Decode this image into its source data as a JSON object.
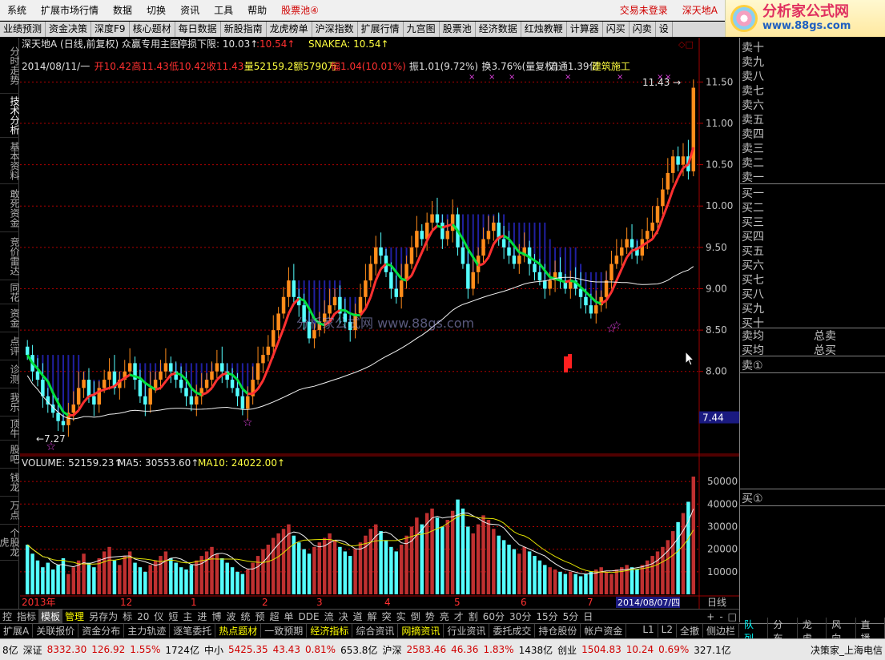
{
  "menu": [
    "系统",
    "扩展市场行情",
    "数据",
    "切换",
    "资讯",
    "工具",
    "帮助"
  ],
  "menu_pool": "股票池④",
  "menu_login": "交易未登录",
  "menu_stock": "深天地A",
  "logo_text": "分析家公式网",
  "logo_url": "www.88gs.com",
  "toolbar": [
    "业绩预测",
    "资金决策",
    "深度F9",
    "核心题材",
    "每日数据",
    "新股指南",
    "龙虎榜单",
    "沪深指数",
    "扩展行情",
    "九宫图",
    "股票池",
    "经济数据",
    "红烛教鞭",
    "计算器",
    "闪买",
    "闪卖",
    "设"
  ],
  "left_tabs": [
    "分时走势",
    "技术分析",
    "基本资料",
    "敢死资金",
    "竞价雷达",
    "同花",
    "资金",
    "点评",
    "诊测",
    "我乐",
    "顶牛",
    "股吧",
    "钱龙",
    "万点",
    "个股龙虎"
  ],
  "chart_header": {
    "title": "深天地A (日线,前复权) 众赢专用主图",
    "stop_loss_label": "停损下限:",
    "stop_loss": "10.03",
    "stop_loss2": "10.54",
    "snakea": "SNAKEA: 10.54"
  },
  "info_line": {
    "date": "2014/08/11/一",
    "open": "开10.42",
    "high": "高11.43",
    "low": "低10.42",
    "close": "收11.43",
    "vol": "量52159.2",
    "amount": "额5790万",
    "amp": "幅1.04(10.01%)",
    "swing": "振1.01(9.72%)",
    "turnover": "换3.76%(量复权)",
    "float": "流通1.39亿",
    "industry": "建筑施工"
  },
  "volume_header": {
    "vol": "VOLUME: 52159.23",
    "ma5": "MA5: 30553.60",
    "ma10": "MA10: 24022.00"
  },
  "annotations": {
    "high_label": "11.43",
    "low_label": "7.27",
    "current_price": "7.44",
    "watermark": "分析家公式网  www.88gs.com",
    "period": "日线",
    "cursor_date": "2014/08/07/四"
  },
  "chart_data": {
    "type": "candlestick",
    "price_axis": {
      "min": 7.0,
      "max": 11.6,
      "ticks": [
        8.0,
        8.5,
        9.0,
        9.5,
        10.0,
        10.5,
        11.0,
        11.5
      ]
    },
    "volume_axis": {
      "min": 0,
      "max": 55000,
      "ticks": [
        10000,
        20000,
        30000,
        40000,
        50000
      ]
    },
    "x_labels": [
      "2013年",
      "12",
      "1",
      "2",
      "3",
      "4",
      "5",
      "6",
      "7"
    ],
    "series": {
      "open": [
        8.3,
        8.2,
        8.0,
        7.9,
        7.7,
        7.6,
        7.5,
        7.4,
        7.35,
        7.5,
        7.6,
        7.8,
        7.9,
        7.7,
        7.6,
        7.8,
        7.9,
        8.0,
        7.8,
        7.9,
        8.0,
        8.1,
        7.9,
        7.7,
        7.6,
        7.8,
        7.9,
        8.0,
        8.1,
        8.0,
        7.9,
        7.8,
        7.7,
        7.6,
        7.7,
        7.8,
        7.9,
        8.0,
        8.1,
        8.0,
        7.9,
        7.8,
        7.7,
        7.55,
        7.7,
        7.9,
        8.1,
        8.2,
        8.3,
        8.5,
        8.7,
        8.9,
        9.1,
        8.9,
        8.8,
        8.6,
        8.4,
        8.5,
        8.6,
        8.7,
        8.8,
        8.9,
        8.7,
        8.6,
        8.5,
        8.7,
        8.9,
        9.1,
        9.3,
        9.5,
        9.4,
        9.2,
        9.0,
        8.9,
        9.1,
        9.3,
        9.5,
        9.7,
        9.6,
        9.8,
        9.9,
        9.8,
        9.6,
        9.7,
        9.9,
        9.5,
        9.3,
        9.0,
        9.2,
        9.4,
        9.6,
        9.7,
        9.8,
        9.6,
        9.5,
        9.4,
        9.3,
        9.4,
        9.5,
        9.3,
        9.2,
        9.1,
        9.0,
        9.1,
        9.2,
        9.1,
        9.0,
        9.1,
        9.0,
        8.9,
        8.8,
        8.7,
        8.8,
        8.9,
        9.1,
        9.3,
        9.4,
        9.5,
        9.6,
        9.5,
        9.4,
        9.6,
        9.7,
        9.8,
        10.0,
        10.2,
        10.4,
        10.6,
        10.5,
        10.6,
        10.42
      ],
      "close": [
        8.2,
        8.0,
        7.9,
        7.7,
        7.6,
        7.5,
        7.4,
        7.35,
        7.5,
        7.6,
        7.8,
        7.9,
        7.7,
        7.6,
        7.8,
        7.9,
        8.0,
        7.8,
        7.9,
        8.0,
        8.1,
        7.9,
        7.7,
        7.6,
        7.8,
        7.9,
        8.0,
        8.1,
        8.0,
        7.9,
        7.8,
        7.7,
        7.6,
        7.7,
        7.8,
        7.9,
        8.0,
        8.1,
        8.0,
        7.9,
        7.8,
        7.7,
        7.55,
        7.7,
        7.9,
        8.1,
        8.2,
        8.3,
        8.5,
        8.7,
        8.9,
        9.1,
        8.9,
        8.8,
        8.6,
        8.4,
        8.5,
        8.6,
        8.7,
        8.8,
        8.9,
        8.7,
        8.6,
        8.5,
        8.7,
        8.9,
        9.1,
        9.3,
        9.5,
        9.4,
        9.2,
        9.0,
        8.9,
        9.1,
        9.3,
        9.5,
        9.7,
        9.6,
        9.8,
        9.9,
        9.8,
        9.6,
        9.7,
        9.9,
        9.5,
        9.3,
        9.0,
        9.2,
        9.4,
        9.6,
        9.7,
        9.8,
        9.6,
        9.5,
        9.4,
        9.3,
        9.4,
        9.5,
        9.3,
        9.2,
        9.1,
        9.0,
        9.1,
        9.2,
        9.1,
        9.0,
        9.1,
        9.0,
        8.9,
        8.8,
        8.7,
        8.8,
        8.9,
        9.1,
        9.3,
        9.4,
        9.5,
        9.6,
        9.5,
        9.4,
        9.6,
        9.7,
        9.8,
        10.0,
        10.2,
        10.4,
        10.6,
        10.5,
        10.6,
        10.42,
        11.43
      ],
      "volume": [
        22000,
        18000,
        15000,
        12000,
        14000,
        11000,
        13000,
        16000,
        9000,
        12000,
        15000,
        18000,
        14000,
        12000,
        16000,
        19000,
        21000,
        15000,
        13000,
        17000,
        19000,
        14000,
        12000,
        10000,
        13000,
        15000,
        17000,
        19000,
        16000,
        14000,
        12000,
        11000,
        13000,
        15000,
        17000,
        19000,
        21000,
        18000,
        16000,
        14000,
        12000,
        10000,
        9000,
        11000,
        14000,
        17000,
        20000,
        22000,
        25000,
        27000,
        29000,
        31000,
        26000,
        23000,
        20000,
        18000,
        21000,
        23000,
        25000,
        27000,
        24000,
        21000,
        19000,
        17000,
        20000,
        23000,
        26000,
        29000,
        31000,
        28000,
        24000,
        21000,
        19000,
        22000,
        26000,
        30000,
        34000,
        31000,
        36000,
        38000,
        34000,
        30000,
        33000,
        37000,
        42000,
        38000,
        30000,
        27000,
        31000,
        35000,
        33000,
        29000,
        26000,
        24000,
        22000,
        20000,
        18000,
        21000,
        19000,
        17000,
        15000,
        13000,
        12000,
        11000,
        10000,
        9000,
        10000,
        9000,
        8000,
        9000,
        10000,
        11000,
        12000,
        10000,
        9000,
        11000,
        12000,
        13000,
        12000,
        11000,
        13000,
        15000,
        17000,
        19000,
        21000,
        24000,
        28000,
        32000,
        36000,
        41000,
        52159
      ]
    }
  },
  "order_book": {
    "sell": [
      "卖十",
      "卖九",
      "卖八",
      "卖七",
      "卖六",
      "卖五",
      "卖四",
      "卖三",
      "卖二",
      "卖一"
    ],
    "buy": [
      "买一",
      "买二",
      "买三",
      "买四",
      "买五",
      "买六",
      "买七",
      "买八",
      "买九",
      "买十"
    ],
    "sell_avg": "卖均",
    "buy_avg": "买均",
    "total_sell": "总卖",
    "total_buy": "总买",
    "sell_q": "卖①",
    "buy_q": "买①"
  },
  "tabstrip": [
    "控",
    "指标",
    "模板",
    "管理",
    "另存为",
    "标",
    "20",
    "仪",
    "短",
    "主",
    "进",
    "博",
    "波",
    "统",
    "预",
    "超",
    "单",
    "DDE",
    "流",
    "决",
    "道",
    "解",
    "突",
    "实",
    "倒",
    "势",
    "亮",
    "才",
    "割",
    "60分",
    "30分",
    "15分",
    "5分",
    "日"
  ],
  "tabstrip_right": [
    "+",
    "-",
    "□"
  ],
  "subtabs": [
    "扩展A",
    "关联报价",
    "资金分布",
    "主力轨迹",
    "逐笔委托",
    "热点题材",
    "一致预期",
    "经济指标",
    "综合资讯",
    "网摘资讯",
    "行业资讯",
    "委托成交",
    "持仓股份",
    "帐户资金"
  ],
  "subtabs_right": [
    "L1",
    "L2",
    "全撤",
    "侧边栏"
  ],
  "right_tabs": [
    "队列",
    "分布",
    "龙虎",
    "风向",
    "直播"
  ],
  "status": [
    {
      "label": "8亿",
      "class": ""
    },
    {
      "label": "深证",
      "class": ""
    },
    {
      "label": "8332.30",
      "class": "red"
    },
    {
      "label": "126.92",
      "class": "red"
    },
    {
      "label": "1.55%",
      "class": "red"
    },
    {
      "label": "1724亿",
      "class": ""
    },
    {
      "label": "中小",
      "class": ""
    },
    {
      "label": "5425.35",
      "class": "red"
    },
    {
      "label": "43.43",
      "class": "red"
    },
    {
      "label": "0.81%",
      "class": "red"
    },
    {
      "label": "653.8亿",
      "class": ""
    },
    {
      "label": "沪深",
      "class": ""
    },
    {
      "label": "2583.46",
      "class": "red"
    },
    {
      "label": "46.36",
      "class": "red"
    },
    {
      "label": "1.83%",
      "class": "red"
    },
    {
      "label": "1438亿",
      "class": ""
    },
    {
      "label": "创业",
      "class": ""
    },
    {
      "label": "1504.83",
      "class": "red"
    },
    {
      "label": "10.24",
      "class": "red"
    },
    {
      "label": "0.69%",
      "class": "red"
    },
    {
      "label": "327.1亿",
      "class": ""
    }
  ],
  "status_end": "决策家_上海电信",
  "colors": {
    "up": "#ff3232",
    "down": "#54ffff",
    "orange": "#ff8c1a",
    "ma_red": "#ff3030",
    "ma_green": "#00e040",
    "ma_white": "#f0f0f0",
    "band": "#2020a0",
    "grid": "#b00000"
  }
}
